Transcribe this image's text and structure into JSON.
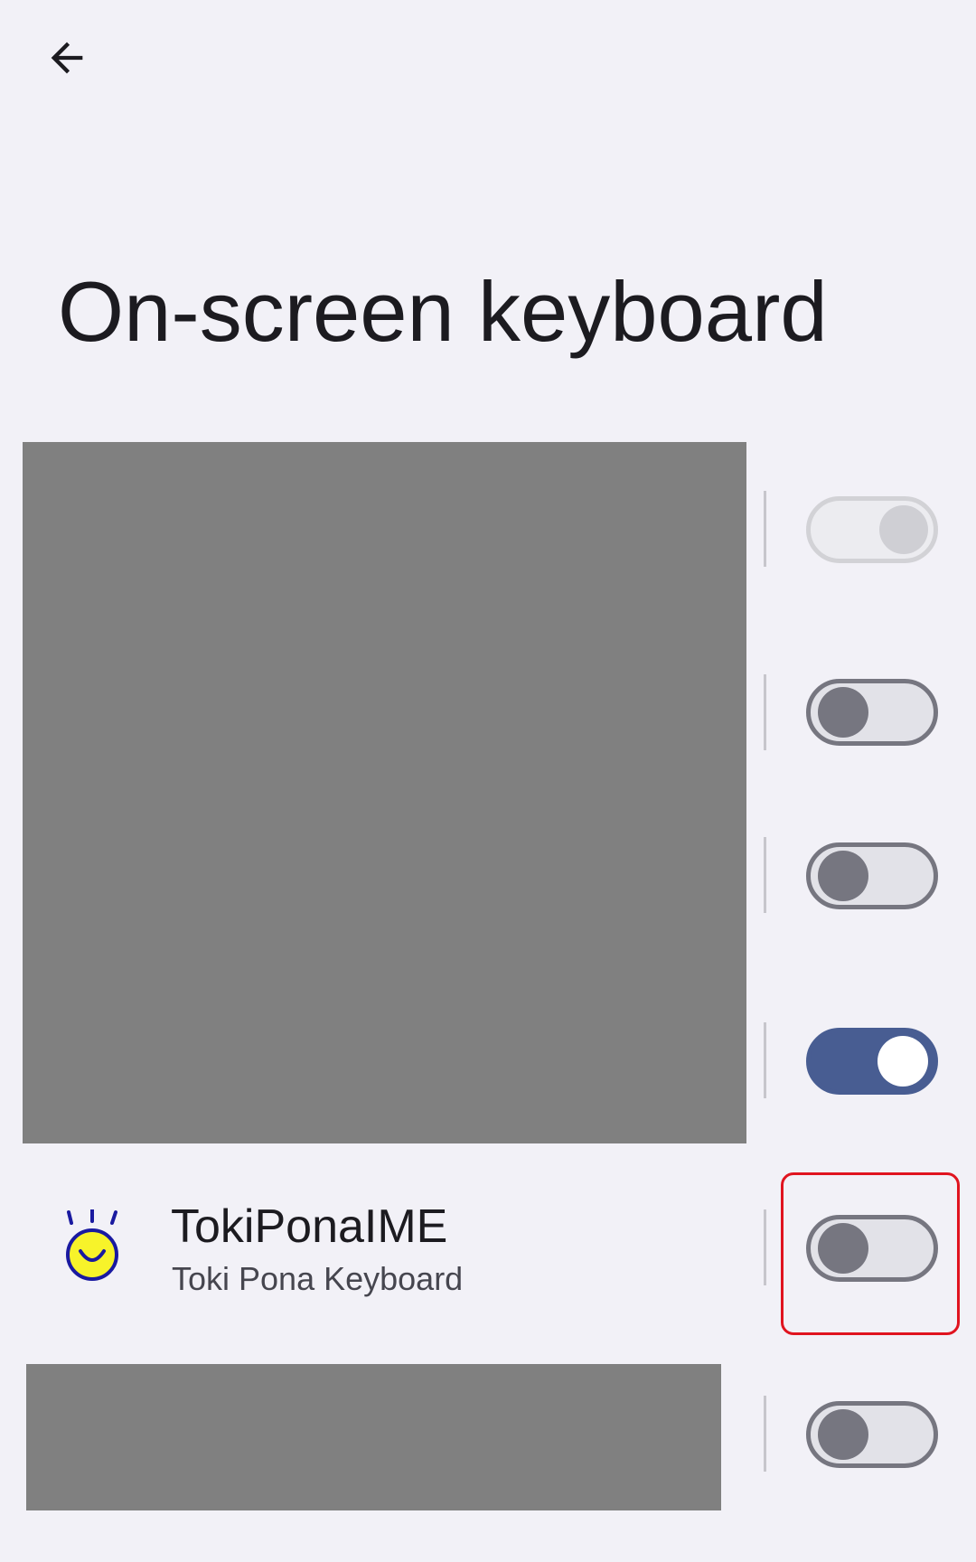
{
  "header": {
    "back_icon": "arrow-back-icon",
    "title": "On-screen keyboard"
  },
  "keyboards": [
    {
      "id": "redacted-1",
      "redacted": true,
      "toggle": "disabled-on"
    },
    {
      "id": "redacted-2",
      "redacted": true,
      "toggle": "off"
    },
    {
      "id": "redacted-3",
      "redacted": true,
      "toggle": "off"
    },
    {
      "id": "redacted-4",
      "redacted": true,
      "toggle": "on"
    },
    {
      "id": "tokiponaime",
      "name": "TokiPonaIME",
      "description": "Toki Pona Keyboard",
      "icon": "toki-pona-smiley-icon",
      "toggle": "off",
      "highlighted": true
    },
    {
      "id": "redacted-6",
      "redacted": true,
      "toggle": "off"
    }
  ],
  "colors": {
    "background": "#f2f1f7",
    "switch_on": "#485d92",
    "switch_off_track": "#e2e2e8",
    "switch_off_outline": "#767680",
    "redaction": "#808080",
    "highlight": "#e0141f"
  }
}
